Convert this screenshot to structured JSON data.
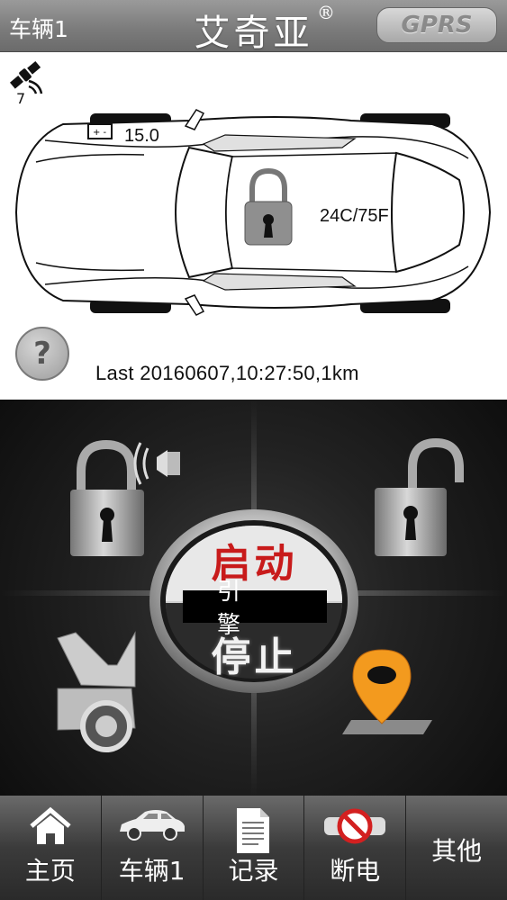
{
  "header": {
    "vehicle_label": "车辆1",
    "brand": "艾奇亚",
    "brand_mark": "®",
    "connection": "GPRS"
  },
  "status": {
    "satellite_count": "7",
    "battery_voltage": "15.0",
    "temperature": "24C/75F",
    "lock_state_icon": "padlock-closed-icon",
    "help_label": "?",
    "last_report": "Last  20160607,10:27:50,1km"
  },
  "controls": {
    "lock_icon": "lock-with-horn-icon",
    "unlock_icon": "padlock-open-icon",
    "trunk_icon": "car-hood-open-icon",
    "locate_icon": "map-pin-icon",
    "engine_start": "启动",
    "engine_label": "引擎",
    "engine_stop": "停止"
  },
  "nav": {
    "items": [
      {
        "label": "主页",
        "icon": "home-icon"
      },
      {
        "label": "车辆1",
        "icon": "car-icon"
      },
      {
        "label": "记录",
        "icon": "document-icon"
      },
      {
        "label": "断电",
        "icon": "power-cut-icon"
      },
      {
        "label": "其他",
        "icon": ""
      }
    ]
  },
  "colors": {
    "accent_red": "#c81b1b",
    "pin_orange": "#f39a1e",
    "header_gray": "#7c7c7c"
  }
}
